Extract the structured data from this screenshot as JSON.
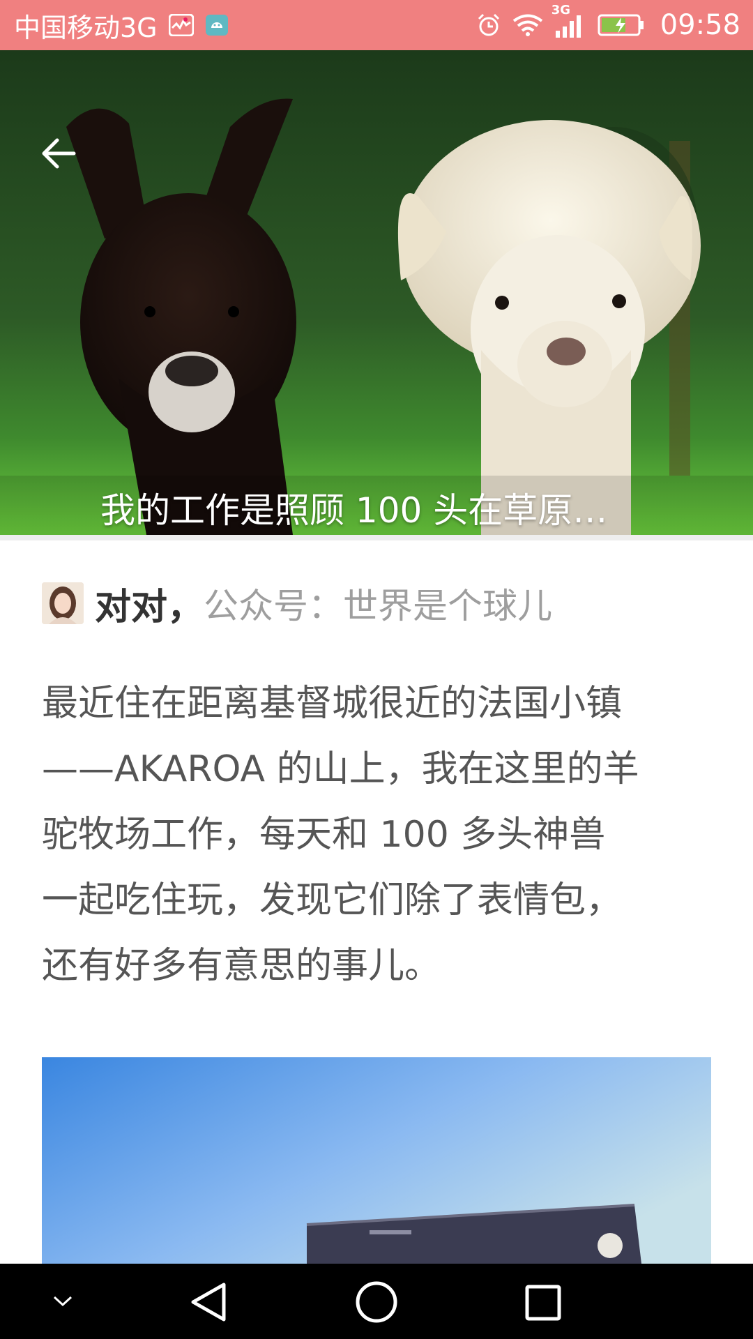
{
  "status_bar": {
    "carrier": "中国移动3G",
    "network_badge": "3G",
    "time": "09:58",
    "icons": [
      "health-app-icon",
      "android-icon",
      "alarm-icon",
      "wifi-icon",
      "signal-icon",
      "battery-charging-icon"
    ],
    "background_color": "#f08080"
  },
  "hero": {
    "title": "我的工作是照顾 100 头在草原…",
    "back_icon": "arrow-left-icon"
  },
  "author": {
    "name": "对对，",
    "source": "公众号：世界是个球儿"
  },
  "article": {
    "lines": [
      "最近住在距离基督城很近的法国小镇",
      "——AKAROA 的山上，我在这里的羊",
      "驼牧场工作，每天和 100 多头神兽",
      "一起吃住玩，发现它们除了表情包，",
      "还有好多有意思的事儿。"
    ]
  },
  "nav_bar": {
    "buttons": [
      "chevron-down-icon",
      "back-triangle-icon",
      "home-circle-icon",
      "recents-square-icon"
    ]
  }
}
